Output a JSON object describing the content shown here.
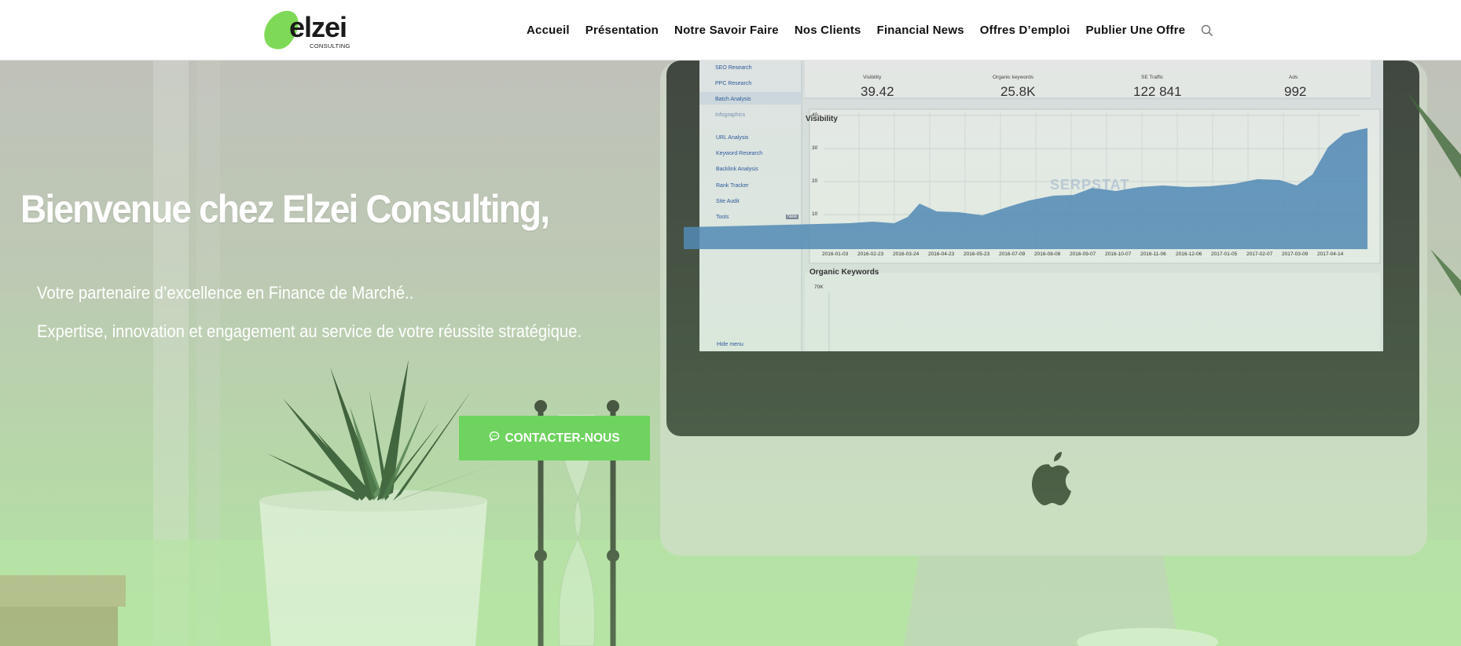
{
  "nav": {
    "logo_text": "elzei",
    "logo_subtext": "CONSULTING",
    "items": [
      {
        "label": "Accueil"
      },
      {
        "label": "Présentation"
      },
      {
        "label": "Notre Savoir Faire"
      },
      {
        "label": "Nos Clients"
      },
      {
        "label": "Financial News"
      },
      {
        "label": "Offres D’emploi"
      },
      {
        "label": "Publier Une Offre"
      }
    ],
    "search_icon": "search-icon"
  },
  "hero": {
    "title": "Bienvenue chez Elzei Consulting,",
    "line1": "Votre partenaire d’excellence en Finance de Marché..",
    "line2": "Expertise, innovation et engagement au service de votre réussite stratégique.",
    "cta_label": "CONTACTER-NOUS",
    "cta_icon": "chat-icon"
  },
  "screen": {
    "sidebar": [
      "SEO Research",
      "PPC Research",
      "Batch Analysis",
      "Infographics",
      "URL Analysis",
      "Keyword Research",
      "Backlink Analysis",
      "Rank Tracker",
      "Site Audit",
      "Tools"
    ],
    "tools_badge": "New",
    "hide_menu": "Hide menu",
    "stats": [
      {
        "label": "Visibility",
        "value": "39.42"
      },
      {
        "label": "Organic keywords",
        "value": "25.8K"
      },
      {
        "label": "SE Traffic",
        "value": "122 841"
      },
      {
        "label": "Ads",
        "value": "992"
      }
    ],
    "chart_title": "Visibility",
    "watermark": "SERPSTAT",
    "yticks": [
      "40",
      "30",
      "20",
      "10"
    ],
    "xticks": [
      "2016-01-03",
      "2016-02-23",
      "2016-03-24",
      "2016-04-23",
      "2016-05-23",
      "2016-07-09",
      "2016-08-08",
      "2016-09-07",
      "2016-10-07",
      "2016-11-06",
      "2016-12-06",
      "2017-01-05",
      "2017-02-07",
      "2017-03-09",
      "2017-04-14"
    ],
    "section2": "Organic Keywords",
    "section2_tick": "70K"
  },
  "colors": {
    "accent": "#6fd35f",
    "logo_green": "#7ed957",
    "chart_blue": "#3d7cc0"
  }
}
